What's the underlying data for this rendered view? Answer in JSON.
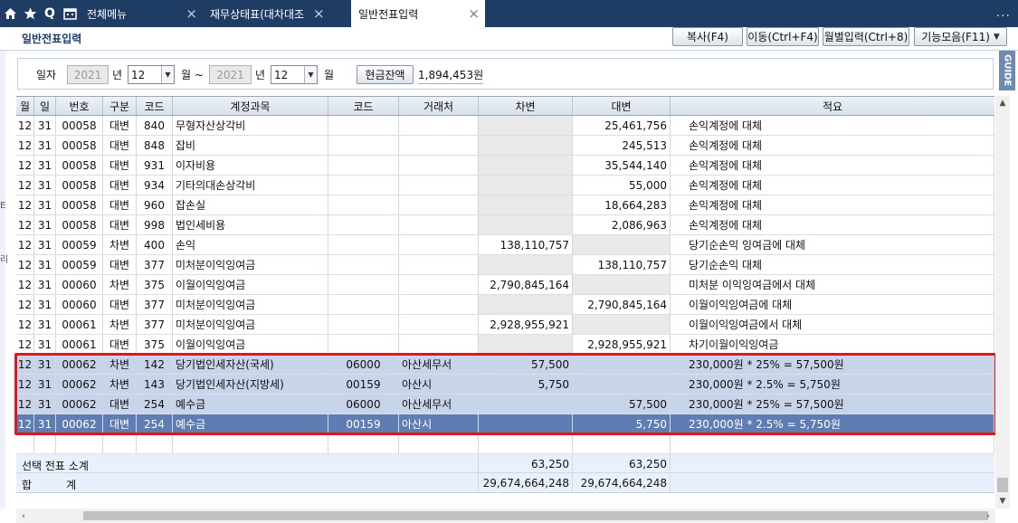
{
  "topbar": {
    "tabs": [
      {
        "label": "전체메뉴"
      },
      {
        "label": "재무상태표(대차대조"
      },
      {
        "label": "일반전표입력"
      }
    ],
    "more": "..."
  },
  "page": {
    "title": "일반전표입력",
    "buttons": {
      "copy": "복사(F4)",
      "move": "이동(Ctrl+F4)",
      "monthly": "월별입력(Ctrl+8)",
      "functions": "기능모음(F11)"
    },
    "guide": "GUIDE",
    "side_marks": [
      "E",
      "리"
    ]
  },
  "filter": {
    "date_label": "일자",
    "year_from": "2021",
    "year_unit": "년",
    "month_from": "12",
    "month_unit": "월 ~",
    "year_to": "2021",
    "year_unit2": "년",
    "month_to": "12",
    "month_unit2": "월",
    "cash_button": "현금잔액",
    "cash_value": "1,894,453원"
  },
  "grid": {
    "headers": [
      "월",
      "일",
      "번호",
      "구분",
      "코드",
      "계정과목",
      "코드",
      "거래처",
      "차변",
      "대변",
      "적요"
    ],
    "rows": [
      {
        "m": "12",
        "d": "31",
        "no": "00058",
        "type": "대변",
        "code": "840",
        "account": "무형자산상각비",
        "pcode": "",
        "partner": "",
        "debit": "",
        "credit": "25,461,756",
        "memo": "손익계정에 대체"
      },
      {
        "m": "12",
        "d": "31",
        "no": "00058",
        "type": "대변",
        "code": "848",
        "account": "잡비",
        "pcode": "",
        "partner": "",
        "debit": "",
        "credit": "245,513",
        "memo": "손익계정에 대체"
      },
      {
        "m": "12",
        "d": "31",
        "no": "00058",
        "type": "대변",
        "code": "931",
        "account": "이자비용",
        "pcode": "",
        "partner": "",
        "debit": "",
        "credit": "35,544,140",
        "memo": "손익계정에 대체"
      },
      {
        "m": "12",
        "d": "31",
        "no": "00058",
        "type": "대변",
        "code": "934",
        "account": "기타의대손상각비",
        "pcode": "",
        "partner": "",
        "debit": "",
        "credit": "55,000",
        "memo": "손익계정에 대체"
      },
      {
        "m": "12",
        "d": "31",
        "no": "00058",
        "type": "대변",
        "code": "960",
        "account": "잡손실",
        "pcode": "",
        "partner": "",
        "debit": "",
        "credit": "18,664,283",
        "memo": "손익계정에 대체"
      },
      {
        "m": "12",
        "d": "31",
        "no": "00058",
        "type": "대변",
        "code": "998",
        "account": "법인세비용",
        "pcode": "",
        "partner": "",
        "debit": "",
        "credit": "2,086,963",
        "memo": "손익계정에 대체"
      },
      {
        "m": "12",
        "d": "31",
        "no": "00059",
        "type": "차변",
        "code": "400",
        "account": "손익",
        "pcode": "",
        "partner": "",
        "debit": "138,110,757",
        "credit": "",
        "memo": "당기순손익 잉여금에 대체"
      },
      {
        "m": "12",
        "d": "31",
        "no": "00059",
        "type": "대변",
        "code": "377",
        "account": "미처분이익잉여금",
        "pcode": "",
        "partner": "",
        "debit": "",
        "credit": "138,110,757",
        "memo": "당기순손익 대체"
      },
      {
        "m": "12",
        "d": "31",
        "no": "00060",
        "type": "차변",
        "code": "375",
        "account": "이월이익잉여금",
        "pcode": "",
        "partner": "",
        "debit": "2,790,845,164",
        "credit": "",
        "memo": "미처분 이익잉여금에서 대체"
      },
      {
        "m": "12",
        "d": "31",
        "no": "00060",
        "type": "대변",
        "code": "377",
        "account": "미처분이익잉여금",
        "pcode": "",
        "partner": "",
        "debit": "",
        "credit": "2,790,845,164",
        "memo": "이월이익잉여금에 대체"
      },
      {
        "m": "12",
        "d": "31",
        "no": "00061",
        "type": "차변",
        "code": "377",
        "account": "미처분이익잉여금",
        "pcode": "",
        "partner": "",
        "debit": "2,928,955,921",
        "credit": "",
        "memo": "이월이익잉여금에서 대체"
      },
      {
        "m": "12",
        "d": "31",
        "no": "00061",
        "type": "대변",
        "code": "375",
        "account": "이월이익잉여금",
        "pcode": "",
        "partner": "",
        "debit": "",
        "credit": "2,928,955,921",
        "memo": "차기이월이익잉여금"
      },
      {
        "m": "12",
        "d": "31",
        "no": "00062",
        "type": "차변",
        "code": "142",
        "account": "당기법인세자산(국세)",
        "pcode": "06000",
        "partner": "아산세무서",
        "debit": "57,500",
        "credit": "",
        "memo": "230,000원 * 25% = 57,500원"
      },
      {
        "m": "12",
        "d": "31",
        "no": "00062",
        "type": "차변",
        "code": "143",
        "account": "당기법인세자산(지방세)",
        "pcode": "00159",
        "partner": "아산시",
        "debit": "5,750",
        "credit": "",
        "memo": "230,000원 * 2.5% = 5,750원"
      },
      {
        "m": "12",
        "d": "31",
        "no": "00062",
        "type": "대변",
        "code": "254",
        "account": "예수금",
        "pcode": "06000",
        "partner": "아산세무서",
        "debit": "",
        "credit": "57,500",
        "memo": "230,000원 * 25% = 57,500원"
      },
      {
        "m": "12",
        "d": "31",
        "no": "00062",
        "type": "대변",
        "code": "254",
        "account": "예수금",
        "pcode": "00159",
        "partner": "아산시",
        "debit": "",
        "credit": "5,750",
        "memo": "230,000원 * 2.5% = 5,750원"
      }
    ],
    "subtotal": {
      "label": "선택 전표 소계",
      "debit": "63,250",
      "credit": "63,250"
    },
    "total": {
      "label": "합          계",
      "debit": "29,674,664,248",
      "credit": "29,674,664,248"
    }
  },
  "colors": {
    "topbar": "#1f3c64",
    "selected_row": "#c7d4e9",
    "current_row": "#5f7db3",
    "highlight_box": "#e0161b"
  }
}
